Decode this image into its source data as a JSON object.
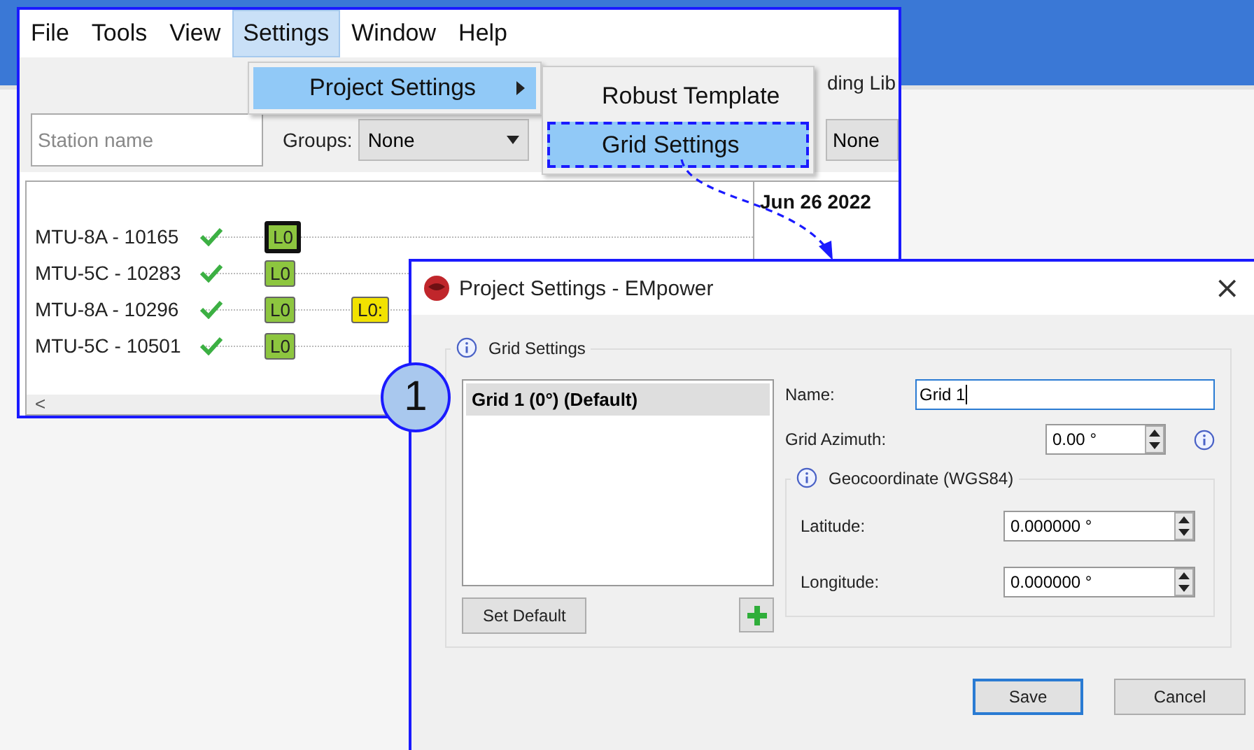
{
  "background_window": {
    "menu_bar": [
      {
        "label": "File",
        "selected": false
      },
      {
        "label": "Tools",
        "selected": false
      },
      {
        "label": "View",
        "selected": false
      },
      {
        "label": "Settings",
        "selected": true
      },
      {
        "label": "Window",
        "selected": false
      },
      {
        "label": "Help",
        "selected": false
      }
    ],
    "menu": {
      "items": [
        {
          "label": "Project Settings",
          "selected": true,
          "has_submenu": true
        }
      ]
    },
    "submenu": {
      "items": [
        {
          "label": "Robust Template",
          "selected": false
        },
        {
          "label": "Grid Settings",
          "selected": true
        }
      ]
    },
    "tab_fragment": "ding Lib",
    "station_field": {
      "placeholder": "Station name"
    },
    "groups": {
      "label": "Groups:",
      "value": "None"
    },
    "filter_fragment": "None",
    "date": "Jun 26 2022",
    "stations": [
      {
        "name": "MTU-8A - 10165",
        "ok": true,
        "tags": [
          {
            "text": "L0",
            "color": "#8dc63f",
            "highlighted": true
          }
        ]
      },
      {
        "name": "MTU-5C - 10283",
        "ok": true,
        "tags": [
          {
            "text": "L0",
            "color": "#8dc63f",
            "highlighted": false
          }
        ]
      },
      {
        "name": "MTU-8A - 10296",
        "ok": true,
        "tags": [
          {
            "text": "L0",
            "color": "#8dc63f",
            "highlighted": false
          },
          {
            "text": "L0:",
            "color": "#f2e200",
            "highlighted": false
          }
        ]
      },
      {
        "name": "MTU-5C - 10501",
        "ok": true,
        "tags": [
          {
            "text": "L0",
            "color": "#8dc63f",
            "highlighted": false
          }
        ]
      }
    ],
    "scroll_arrow": "<"
  },
  "dialog": {
    "title": "Project Settings - EMpower",
    "close": "×",
    "group_title": "Grid Settings",
    "grids": [
      {
        "label": "Grid 1 (0°) (Default)",
        "selected": true
      }
    ],
    "set_default": "Set Default",
    "name": {
      "label": "Name:",
      "value": "Grid 1"
    },
    "azimuth": {
      "label": "Grid Azimuth:",
      "value": "0.00 °"
    },
    "geo": {
      "title": "Geocoordinate (WGS84)",
      "fields": [
        {
          "label": "Latitude:",
          "value": "0.000000 °"
        },
        {
          "label": "Longitude:",
          "value": "0.000000 °"
        }
      ]
    },
    "buttons": [
      {
        "label": "Save",
        "default": true
      },
      {
        "label": "Cancel",
        "default": false
      }
    ]
  },
  "callout": {
    "number": "1"
  }
}
